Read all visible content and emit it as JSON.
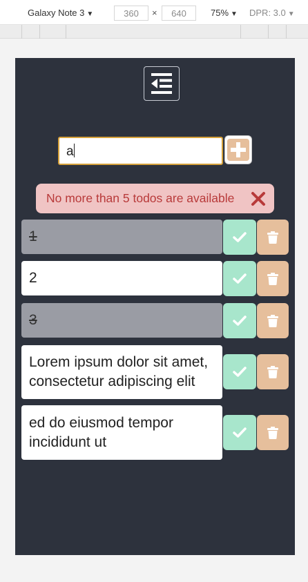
{
  "devtools": {
    "device": "Galaxy Note 3",
    "width": "360",
    "times": "×",
    "height": "640",
    "zoom": "75%",
    "dpr": "DPR: 3.0"
  },
  "app": {
    "input_value": "a",
    "alert_text": "No more than 5 todos are available",
    "todos": [
      {
        "text": "1",
        "completed": true
      },
      {
        "text": "2",
        "completed": false
      },
      {
        "text": "3",
        "completed": true
      },
      {
        "text": "Lorem ipsum dolor sit amet, consectetur adipiscing elit",
        "completed": false
      },
      {
        "text": "ed do eiusmod tempor incididunt ut",
        "completed": false
      }
    ]
  },
  "colors": {
    "app_background": "#2d323d",
    "done_button": "#a8e6cc",
    "delete_button": "#e6bf9c",
    "alert_background": "#f0c4c4",
    "alert_text": "#b83a3a",
    "completed_item": "#9a9ca4"
  },
  "icons": {
    "menu": "outdent-menu-icon",
    "add": "plus-icon",
    "close": "close-x-icon",
    "done": "check-icon",
    "delete": "trash-icon"
  }
}
